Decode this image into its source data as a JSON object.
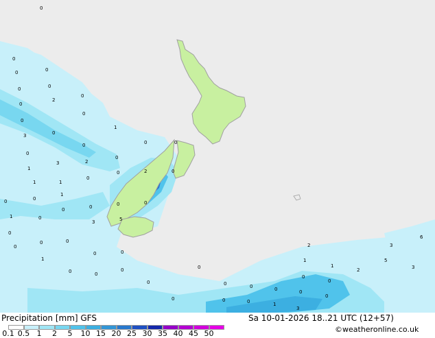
{
  "map": {
    "sea_color": "#ececec",
    "land_color": "#c8f0a0",
    "coast_color": "#a0a0a0",
    "grid_values": [
      "0",
      "0",
      "0",
      "0",
      "0",
      "0",
      "0",
      "0",
      "2",
      "0",
      "0",
      "1",
      "3",
      "0",
      "0",
      "0",
      "3",
      "2",
      "0",
      "1",
      "1",
      "0",
      "0",
      "0",
      "2",
      "0",
      "1",
      "1",
      "0",
      "0",
      "0",
      "0",
      "0",
      "0",
      "0",
      "3",
      "5",
      "1",
      "0",
      "0",
      "0",
      "0",
      "0",
      "0",
      "0",
      "1",
      "0",
      "0",
      "0",
      "0",
      "1",
      "1",
      "0",
      "0",
      "0",
      "0",
      "0",
      "0",
      "1",
      "3",
      "2",
      "2",
      "3",
      "6",
      "5",
      "3",
      "0",
      "0",
      "0",
      "0",
      "0"
    ]
  },
  "footer": {
    "title": "Precipitation [mm] GFS",
    "datetime": "Sa 10-01-2026 18..21 UTC (12+57)",
    "credit": "©weatheronline.co.uk",
    "legend": [
      {
        "label": "0.1",
        "color": "#ffffff"
      },
      {
        "label": "0.5",
        "color": "#c8f0fa"
      },
      {
        "label": "1",
        "color": "#a0e6f5"
      },
      {
        "label": "2",
        "color": "#78d7f0"
      },
      {
        "label": "5",
        "color": "#50c3eb"
      },
      {
        "label": "10",
        "color": "#3cafe1"
      },
      {
        "label": "15",
        "color": "#3296d7"
      },
      {
        "label": "20",
        "color": "#2878cd"
      },
      {
        "label": "25",
        "color": "#1e50c3"
      },
      {
        "label": "30",
        "color": "#1428aa"
      },
      {
        "label": "35",
        "color": "#9600c8"
      },
      {
        "label": "40",
        "color": "#b400d2"
      },
      {
        "label": "45",
        "color": "#d200dc"
      },
      {
        "label": "50",
        "color": "#e600e6"
      }
    ]
  }
}
